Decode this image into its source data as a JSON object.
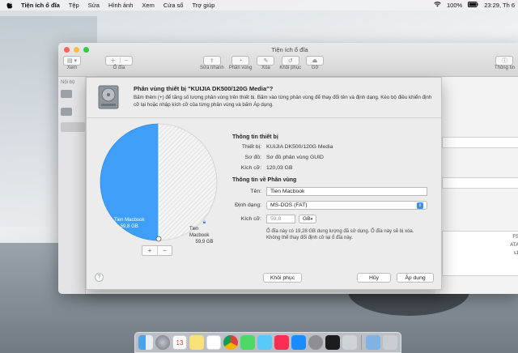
{
  "menubar": {
    "items": [
      "Tiện ích ổ đĩa",
      "Tệp",
      "Sửa",
      "Hình ảnh",
      "Xem",
      "Cửa sổ",
      "Trợ giúp"
    ],
    "battery": "100%",
    "clock": "23:29, Th 6"
  },
  "window": {
    "title": "Tiện ích ổ đĩa",
    "toolbar": {
      "view_label": "Xem",
      "volume_label": "Ổ đĩa",
      "actions": [
        "Sửa nhanh",
        "Phân vùng",
        "Xóa",
        "Khôi phục",
        "Gỡ"
      ],
      "info_label": "Thông tin"
    },
    "sidebar_heading": "Nội bộ",
    "right_panel_fragments": [
      "FS",
      "ATA",
      "s1"
    ]
  },
  "sheet": {
    "title": "Phân vùng thiết bị \"KUIJIA DK500/120G Media\"?",
    "description": "Bấm thêm (+) để tăng số lượng phân vùng trên thiết bị. Bấm vào từng phân vùng để thay đổi tên và định dạng. Kéo bộ điều khiển định cỡ lại hoặc nhập kích cỡ của từng phân vùng và bấm Áp dụng.",
    "pie": {
      "slice1_name": "Tien Macbook",
      "slice1_size": "59,8 GB",
      "slice2_name": "Tien Macbook",
      "slice2_size": "59,9 GB",
      "add": "+",
      "remove": "−"
    },
    "device_info": {
      "heading": "Thông tin thiết bị",
      "device_key": "Thiết bị:",
      "device_val": "KUIJIA DK500/120G Media",
      "scheme_key": "Sơ đồ:",
      "scheme_val": "Sơ đồ phân vùng GUID",
      "size_key": "Kích cỡ:",
      "size_val": "120,03 GB"
    },
    "partition_info": {
      "heading": "Thông tin về Phân vùng",
      "name_key": "Tên:",
      "name_val": "Tien Macbook",
      "format_key": "Định dạng:",
      "format_val": "MS-DOS (FAT)",
      "size_key": "Kích cỡ:",
      "size_val": "59,8",
      "unit": "GB",
      "note": "Ổ đĩa này có 19,28 GB dung lượng đã sử dụng. Ổ đĩa này sẽ bị xóa. Không thể thay đổi định cỡ lại ổ đĩa này."
    },
    "footer": {
      "help": "?",
      "revert": "Khôi phục",
      "cancel": "Hủy",
      "apply": "Áp dụng"
    }
  },
  "chart_data": {
    "type": "pie",
    "categories": [
      "Tien Macbook",
      "Tien Macbook"
    ],
    "values": [
      59.8,
      59.9
    ],
    "unit": "GB"
  },
  "colors": {
    "accent": "#3a8ef6",
    "pie_blue": "#3f9ef7",
    "close": "#fc605b",
    "minimize": "#fdbc40",
    "zoom": "#34c84a"
  }
}
